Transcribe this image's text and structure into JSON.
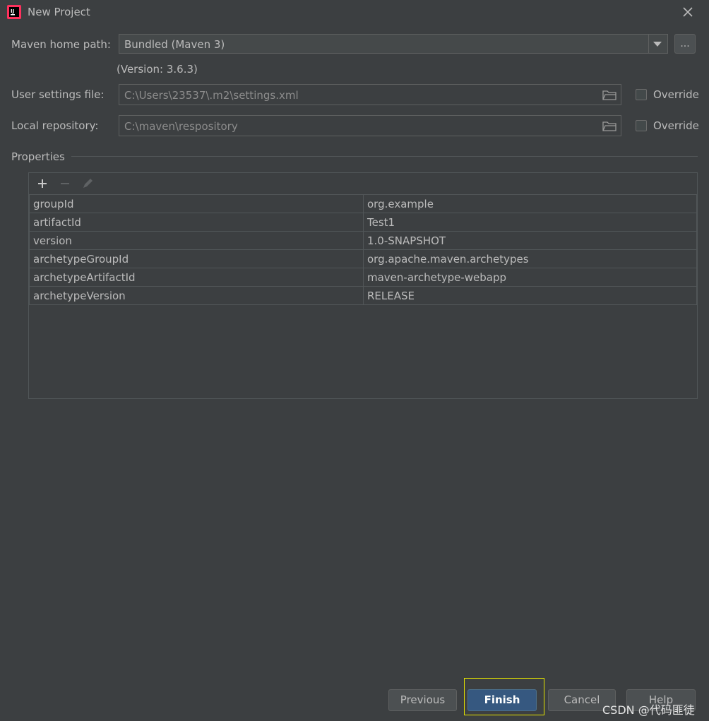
{
  "window": {
    "title": "New Project",
    "app_icon": "intellij-idea-icon",
    "close_icon": "close-icon"
  },
  "maven_home": {
    "label": "Maven home path:",
    "value": "Bundled (Maven 3)",
    "browse_label": "...",
    "version": "(Version: 3.6.3)"
  },
  "user_settings": {
    "label": "User settings file:",
    "value": "C:\\Users\\23537\\.m2\\settings.xml",
    "override_label": "Override",
    "override_checked": false
  },
  "local_repo": {
    "label": "Local repository:",
    "value": "C:\\maven\\respository",
    "override_label": "Override",
    "override_checked": false
  },
  "properties": {
    "label": "Properties",
    "rows": [
      {
        "key": "groupId",
        "value": "org.example"
      },
      {
        "key": "artifactId",
        "value": "Test1"
      },
      {
        "key": "version",
        "value": "1.0-SNAPSHOT"
      },
      {
        "key": "archetypeGroupId",
        "value": "org.apache.maven.archetypes"
      },
      {
        "key": "archetypeArtifactId",
        "value": "maven-archetype-webapp"
      },
      {
        "key": "archetypeVersion",
        "value": "RELEASE"
      }
    ]
  },
  "footer": {
    "previous": "Previous",
    "finish": "Finish",
    "cancel": "Cancel",
    "help": "Help"
  },
  "watermark": "CSDN @代码匪徒",
  "colors": {
    "background": "#3c3f41",
    "primary_button": "#365880",
    "focus_outline": "#e5e500"
  }
}
